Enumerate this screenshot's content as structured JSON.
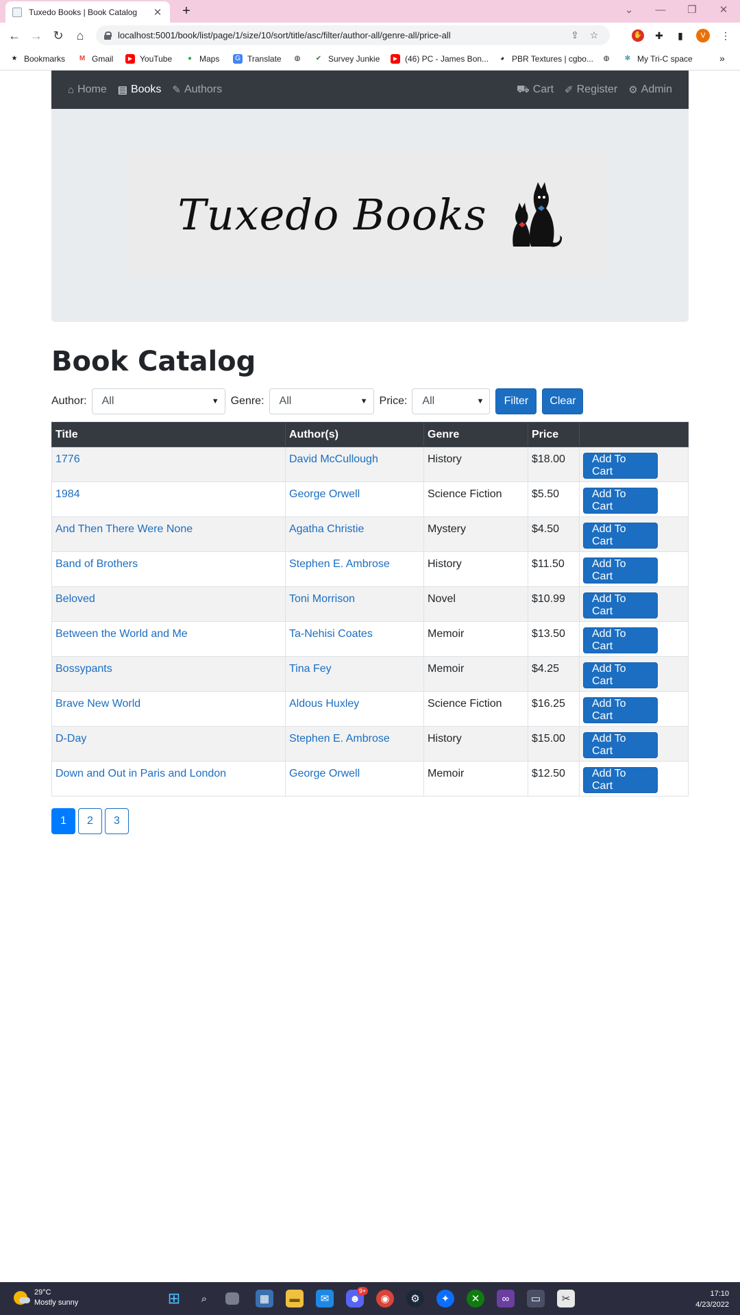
{
  "browser": {
    "tab_title": "Tuxedo Books | Book Catalog",
    "tab_close": "✕",
    "new_tab": "+",
    "url": "localhost:5001/book/list/page/1/size/10/sort/title/asc/filter/author-all/genre-all/price-all",
    "profile_initial": "V",
    "bookmarks": [
      {
        "label": "Bookmarks",
        "icon": "star-icon"
      },
      {
        "label": "Gmail",
        "icon": "gmail-icon"
      },
      {
        "label": "YouTube",
        "icon": "youtube-icon"
      },
      {
        "label": "Maps",
        "icon": "maps-icon"
      },
      {
        "label": "Translate",
        "icon": "translate-icon"
      },
      {
        "label": "",
        "icon": "globe-icon"
      },
      {
        "label": "Survey Junkie",
        "icon": "check-icon"
      },
      {
        "label": "(46) PC - James Bon...",
        "icon": "youtube-icon"
      },
      {
        "label": "PBR Textures | cgbo...",
        "icon": "palette-icon"
      },
      {
        "label": "",
        "icon": "globe-icon"
      },
      {
        "label": "My Tri-C space",
        "icon": "tri-c-icon"
      }
    ],
    "bookmarks_overflow": "»"
  },
  "nav": {
    "left": [
      {
        "label": "Home",
        "icon": "home-icon",
        "active": false
      },
      {
        "label": "Books",
        "icon": "book-icon",
        "active": true
      },
      {
        "label": "Authors",
        "icon": "feather-icon",
        "active": false
      }
    ],
    "right": [
      {
        "label": "Cart",
        "icon": "cart-icon"
      },
      {
        "label": "Register",
        "icon": "edit-icon"
      },
      {
        "label": "Admin",
        "icon": "gear-icon"
      }
    ]
  },
  "logo": {
    "text": "Tuxedo Books"
  },
  "page_title": "Book Catalog",
  "filters": {
    "author_label": "Author:",
    "author_value": "All",
    "genre_label": "Genre:",
    "genre_value": "All",
    "price_label": "Price:",
    "price_value": "All",
    "filter_button": "Filter",
    "clear_button": "Clear"
  },
  "table": {
    "headers": [
      "Title",
      "Author(s)",
      "Genre",
      "Price",
      ""
    ],
    "add_to_cart_label": "Add To Cart",
    "rows": [
      {
        "title": "1776",
        "author": "David McCullough",
        "genre": "History",
        "price": "$18.00"
      },
      {
        "title": "1984",
        "author": "George Orwell",
        "genre": "Science Fiction",
        "price": "$5.50"
      },
      {
        "title": "And Then There Were None",
        "author": "Agatha Christie",
        "genre": "Mystery",
        "price": "$4.50"
      },
      {
        "title": "Band of Brothers",
        "author": "Stephen E. Ambrose",
        "genre": "History",
        "price": "$11.50"
      },
      {
        "title": "Beloved",
        "author": "Toni Morrison",
        "genre": "Novel",
        "price": "$10.99"
      },
      {
        "title": "Between the World and Me",
        "author": "Ta-Nehisi Coates",
        "genre": "Memoir",
        "price": "$13.50"
      },
      {
        "title": "Bossypants",
        "author": "Tina Fey",
        "genre": "Memoir",
        "price": "$4.25"
      },
      {
        "title": "Brave New World",
        "author": "Aldous Huxley",
        "genre": "Science Fiction",
        "price": "$16.25"
      },
      {
        "title": "D-Day",
        "author": "Stephen E. Ambrose",
        "genre": "History",
        "price": "$15.00"
      },
      {
        "title": "Down and Out in Paris and London",
        "author": "George Orwell",
        "genre": "Memoir",
        "price": "$12.50"
      }
    ]
  },
  "pagination": {
    "pages": [
      "1",
      "2",
      "3"
    ],
    "current": "1"
  },
  "taskbar": {
    "weather_temp": "29°C",
    "weather_desc": "Mostly sunny",
    "time": "17:10",
    "date": "4/23/2022",
    "discord_badge": "9+"
  },
  "colors": {
    "accent": "#1b6ec2",
    "navbar": "#343a40",
    "jumbotron": "#e9ecef",
    "tabstrip": "#f5cde0",
    "taskbar": "#2b2d3f"
  }
}
